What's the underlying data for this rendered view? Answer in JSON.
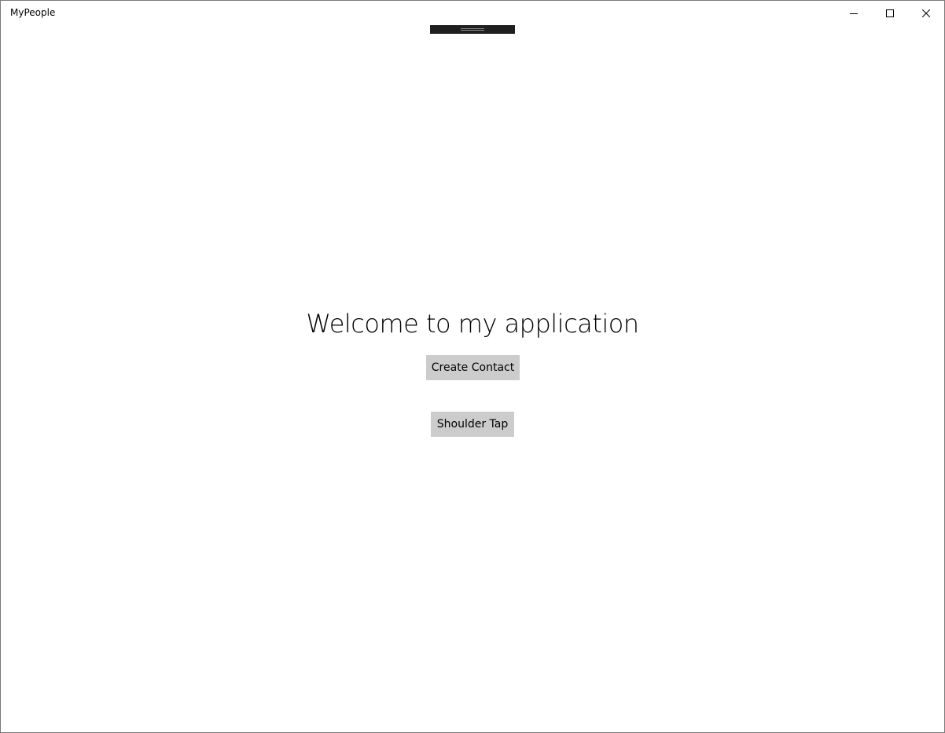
{
  "window": {
    "title": "MyPeople",
    "controls": {
      "minimize_icon": "minimize-icon",
      "maximize_icon": "maximize-icon",
      "close_icon": "close-icon"
    }
  },
  "main": {
    "heading": "Welcome to my application",
    "create_contact_label": "Create Contact",
    "shoulder_tap_label": "Shoulder Tap"
  },
  "colors": {
    "button_background": "#cccccc",
    "drag_handle": "#1f1f1f",
    "text": "#000000",
    "background": "#ffffff"
  }
}
